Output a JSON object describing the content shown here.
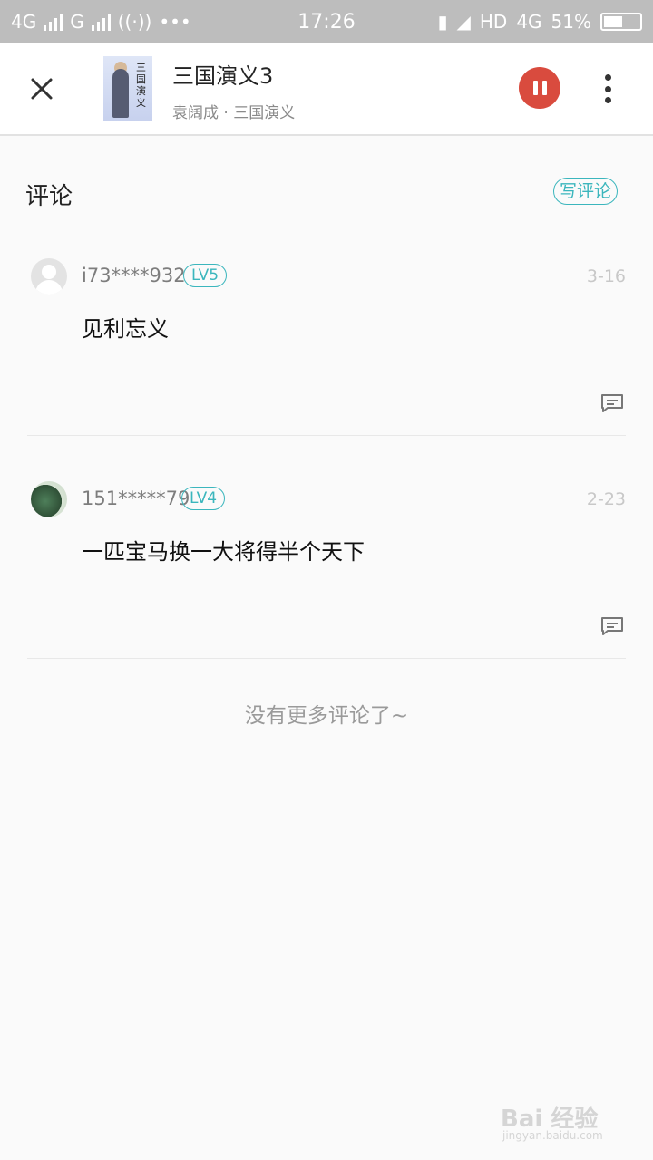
{
  "status_bar": {
    "network_1": "4G",
    "network_2": "G",
    "time": "17:26",
    "hd": "HD",
    "network_3": "4G",
    "battery": "51%"
  },
  "header": {
    "title": "三国演义3",
    "subtitle": "袁阔成 · 三国演义",
    "cover_text": "三国演义"
  },
  "section": {
    "title": "评论",
    "write_button": "写评论"
  },
  "comments": [
    {
      "user": "i73****932",
      "level": "LV5",
      "date": "3-16",
      "text": "见利忘义"
    },
    {
      "user": "151*****79",
      "level": "LV4",
      "date": "2-23",
      "text": "一匹宝马换一大将得半个天下"
    }
  ],
  "footer": {
    "no_more": "没有更多评论了~"
  },
  "watermark": {
    "brand": "Bai 经验",
    "url": "jingyan.baidu.com"
  }
}
